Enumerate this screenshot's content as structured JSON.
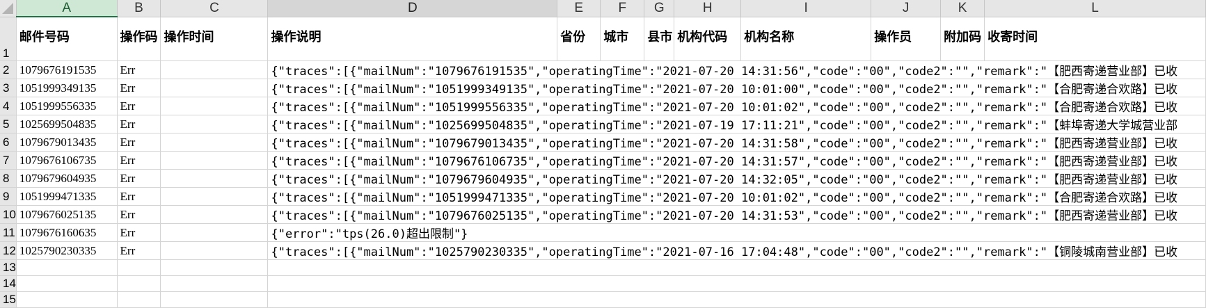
{
  "columns": [
    "A",
    "B",
    "C",
    "D",
    "E",
    "F",
    "G",
    "H",
    "I",
    "J",
    "K",
    "L"
  ],
  "headers": [
    "邮件号码",
    "操作码",
    "操作时间",
    "操作说明",
    "省份",
    "城市",
    "县市",
    "机构代码",
    "机构名称",
    "操作员",
    "附加码",
    "收寄时间"
  ],
  "rows": [
    {
      "n": "2",
      "a": "1079676191535",
      "b": "Err",
      "d": "{\"traces\":[{\"mailNum\":\"1079676191535\",\"operatingTime\":\"2021-07-20 14:31:56\",\"code\":\"00\",\"code2\":\"\",\"remark\":\"【肥西寄递营业部】已收"
    },
    {
      "n": "3",
      "a": "1051999349135",
      "b": "Err",
      "d": "{\"traces\":[{\"mailNum\":\"1051999349135\",\"operatingTime\":\"2021-07-20 10:01:00\",\"code\":\"00\",\"code2\":\"\",\"remark\":\"【合肥寄递合欢路】已收"
    },
    {
      "n": "4",
      "a": "1051999556335",
      "b": "Err",
      "d": "{\"traces\":[{\"mailNum\":\"1051999556335\",\"operatingTime\":\"2021-07-20 10:01:02\",\"code\":\"00\",\"code2\":\"\",\"remark\":\"【合肥寄递合欢路】已收"
    },
    {
      "n": "5",
      "a": "1025699504835",
      "b": "Err",
      "d": "{\"traces\":[{\"mailNum\":\"1025699504835\",\"operatingTime\":\"2021-07-19 17:11:21\",\"code\":\"00\",\"code2\":\"\",\"remark\":\"【蚌埠寄递大学城营业部"
    },
    {
      "n": "6",
      "a": "1079679013435",
      "b": "Err",
      "d": "{\"traces\":[{\"mailNum\":\"1079679013435\",\"operatingTime\":\"2021-07-20 14:31:58\",\"code\":\"00\",\"code2\":\"\",\"remark\":\"【肥西寄递营业部】已收"
    },
    {
      "n": "7",
      "a": "1079676106735",
      "b": "Err",
      "d": "{\"traces\":[{\"mailNum\":\"1079676106735\",\"operatingTime\":\"2021-07-20 14:31:57\",\"code\":\"00\",\"code2\":\"\",\"remark\":\"【肥西寄递营业部】已收"
    },
    {
      "n": "8",
      "a": "1079679604935",
      "b": "Err",
      "d": "{\"traces\":[{\"mailNum\":\"1079679604935\",\"operatingTime\":\"2021-07-20 14:32:05\",\"code\":\"00\",\"code2\":\"\",\"remark\":\"【肥西寄递营业部】已收"
    },
    {
      "n": "9",
      "a": "1051999471335",
      "b": "Err",
      "d": "{\"traces\":[{\"mailNum\":\"1051999471335\",\"operatingTime\":\"2021-07-20 10:01:02\",\"code\":\"00\",\"code2\":\"\",\"remark\":\"【合肥寄递合欢路】已收"
    },
    {
      "n": "10",
      "a": "1079676025135",
      "b": "Err",
      "d": "{\"traces\":[{\"mailNum\":\"1079676025135\",\"operatingTime\":\"2021-07-20 14:31:53\",\"code\":\"00\",\"code2\":\"\",\"remark\":\"【肥西寄递营业部】已收"
    },
    {
      "n": "11",
      "a": "1079676160635",
      "b": "Err",
      "d": "{\"error\":\"tps(26.0)超出限制\"}"
    },
    {
      "n": "12",
      "a": "1025790230335",
      "b": "Err",
      "d": "{\"traces\":[{\"mailNum\":\"1025790230335\",\"operatingTime\":\"2021-07-16 17:04:48\",\"code\":\"00\",\"code2\":\"\",\"remark\":\"【铜陵城南营业部】已收"
    },
    {
      "n": "13",
      "a": "",
      "b": "",
      "d": ""
    },
    {
      "n": "14",
      "a": "",
      "b": "",
      "d": ""
    },
    {
      "n": "15",
      "a": "",
      "b": "",
      "d": ""
    }
  ],
  "first_row_number": "1",
  "colors": {
    "header_bg": "#e6e6e6",
    "selected_col": "#cfe8d6",
    "accent": "#217346",
    "grid": "#d4d4d4"
  }
}
